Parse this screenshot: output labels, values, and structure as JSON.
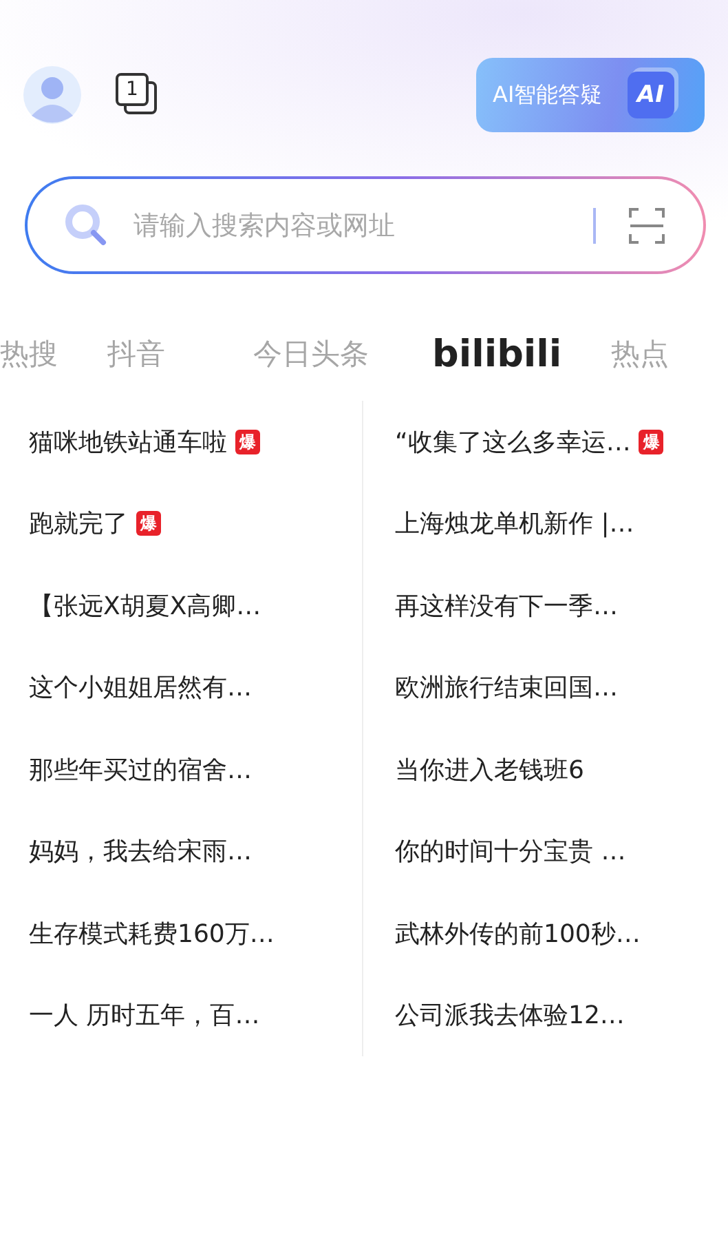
{
  "header": {
    "tab_count": "1",
    "ai_button": {
      "label": "AI智能答疑",
      "icon_text": "AI"
    }
  },
  "search": {
    "placeholder": "请输入搜索内容或网址"
  },
  "tabs": [
    {
      "label": "热搜",
      "selected": false
    },
    {
      "label": "抖音",
      "selected": false
    },
    {
      "label": "今日头条",
      "selected": false
    },
    {
      "label": "bilibili",
      "selected": true
    },
    {
      "label": "热点",
      "selected": false
    }
  ],
  "columns": [
    [
      {
        "title": "猫咪地铁站通车啦",
        "badge": "爆"
      },
      {
        "title": "跑就完了",
        "badge": "爆"
      },
      {
        "title": "【张远X胡夏X高卿…"
      },
      {
        "title": "这个小姐姐居然有…"
      },
      {
        "title": "那些年买过的宿舍…"
      },
      {
        "title": "妈妈，我去给宋雨…"
      },
      {
        "title": "生存模式耗费160万…"
      },
      {
        "title": "一人 历时五年，百…"
      }
    ],
    [
      {
        "title": "“收集了这么多幸运…",
        "badge": "爆"
      },
      {
        "title": "上海烛龙单机新作 |…"
      },
      {
        "title": "再这样没有下一季…"
      },
      {
        "title": "欧洲旅行结束回国…"
      },
      {
        "title": "当你进入老钱班6"
      },
      {
        "title": "你的时间十分宝贵 …"
      },
      {
        "title": "武林外传的前100秒…"
      },
      {
        "title": "公司派我去体验12…"
      }
    ]
  ]
}
